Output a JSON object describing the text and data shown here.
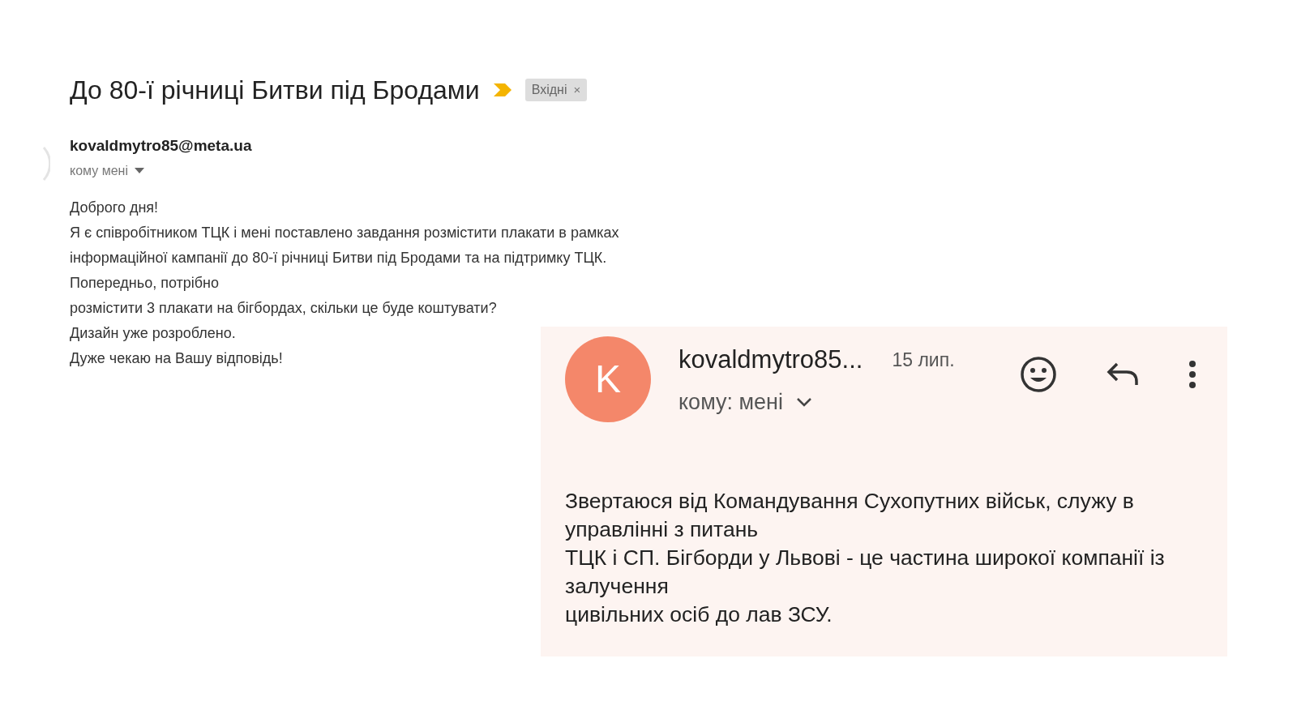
{
  "email": {
    "subject": "До 80-ї річниці Битви під Бродами",
    "important": true,
    "label": {
      "text": "Вхідні",
      "close": "×"
    },
    "sender": "kovaldmytro85@meta.ua",
    "recipient": "кому мені",
    "body": [
      "Доброго дня!",
      "Я є співробітником ТЦК і мені поставлено завдання розмістити плакати в рамках інформаційної кампанії до 80-ї річниці Битви під Бродами та на підтримку ТЦК. Попередньо, потрібно",
      "розмістити 3 плакати на бігбордах, скільки це буде коштувати?",
      "Дизайн уже розроблено.",
      "Дуже чекаю на Вашу відповідь!"
    ]
  },
  "reply": {
    "avatar": {
      "text": "K",
      "color": "#f4876a"
    },
    "sender": "kovaldmytro85...",
    "date": "15 лип.",
    "recipient": "кому: мені",
    "body": [
      "Звертаюся від Командування Сухопутних військ, служу в управлінні з питань",
      "ТЦК і СП. Бігборди у Львові - це частина широкої компанії із залучення",
      "цивільних осіб до лав ЗСУ."
    ]
  }
}
